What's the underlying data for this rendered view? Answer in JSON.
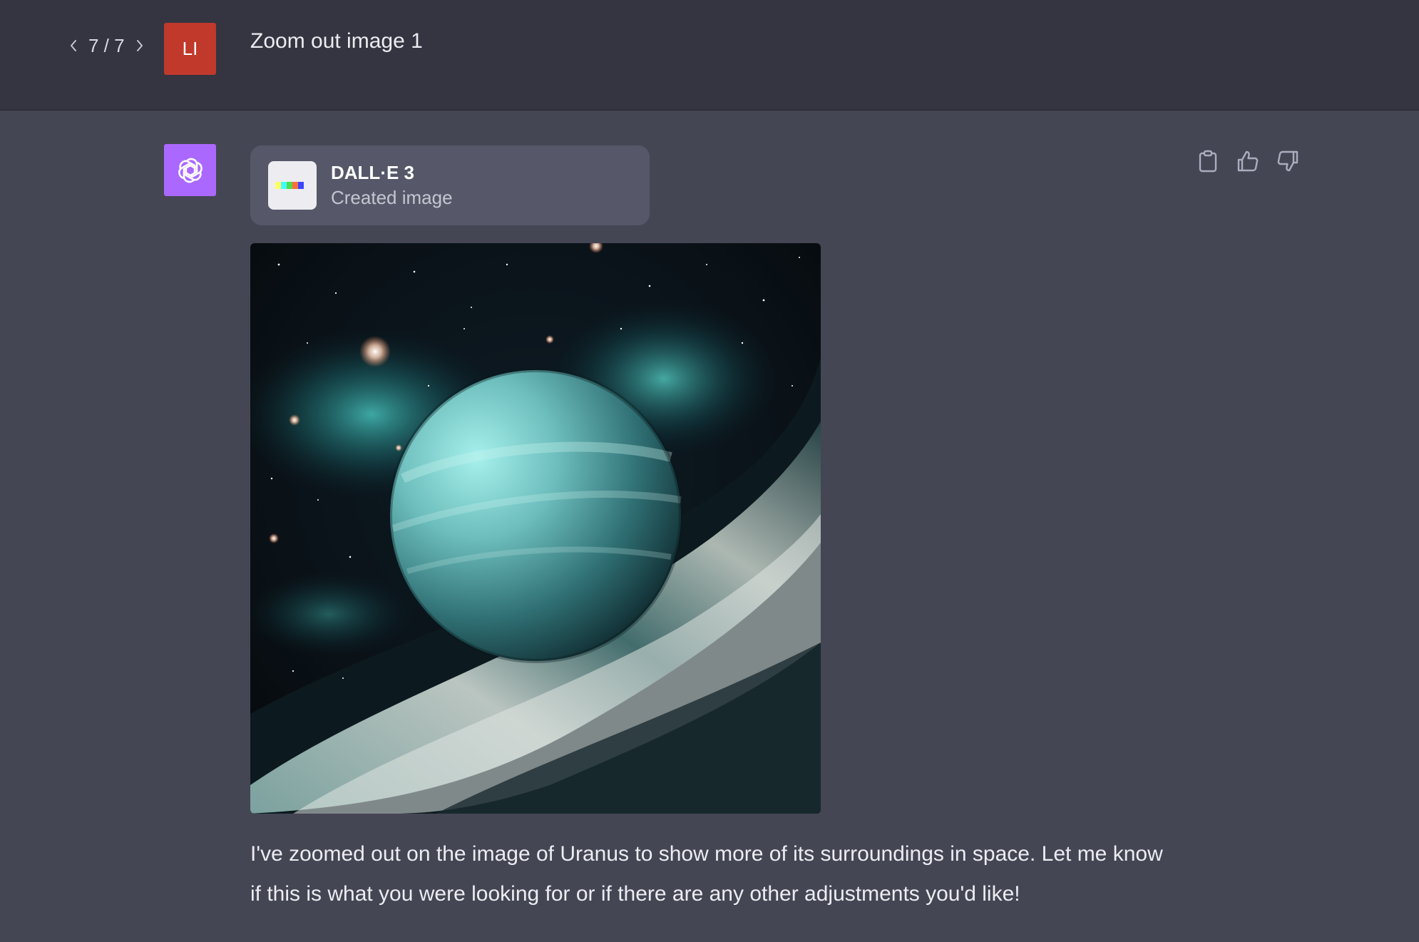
{
  "user_turn": {
    "pager": {
      "prev_icon": "chevron-left-icon",
      "label": "7 / 7",
      "next_icon": "chevron-right-icon"
    },
    "avatar_initials": "LI",
    "avatar_color": "#c0392b",
    "message": "Zoom out image 1"
  },
  "assistant_turn": {
    "avatar_icon": "openai-logo-icon",
    "avatar_color": "#ab68ff",
    "tool_card": {
      "name": "DALL·E 3",
      "status": "Created image",
      "icon": "dalle-palette-icon"
    },
    "actions": [
      {
        "name": "copy",
        "icon": "clipboard-icon"
      },
      {
        "name": "thumbs-up",
        "icon": "thumbs-up-icon"
      },
      {
        "name": "thumbs-down",
        "icon": "thumbs-down-icon"
      }
    ],
    "image_subject": "uranus-planet-in-space",
    "message": "I've zoomed out on the image of Uranus to show more of its surroundings in space. Let me know if this is what you were looking for or if there are any other adjustments you'd like!"
  },
  "colors": {
    "user_bg": "#343541",
    "assistant_bg": "#444654",
    "tool_card_bg": "#565869"
  }
}
